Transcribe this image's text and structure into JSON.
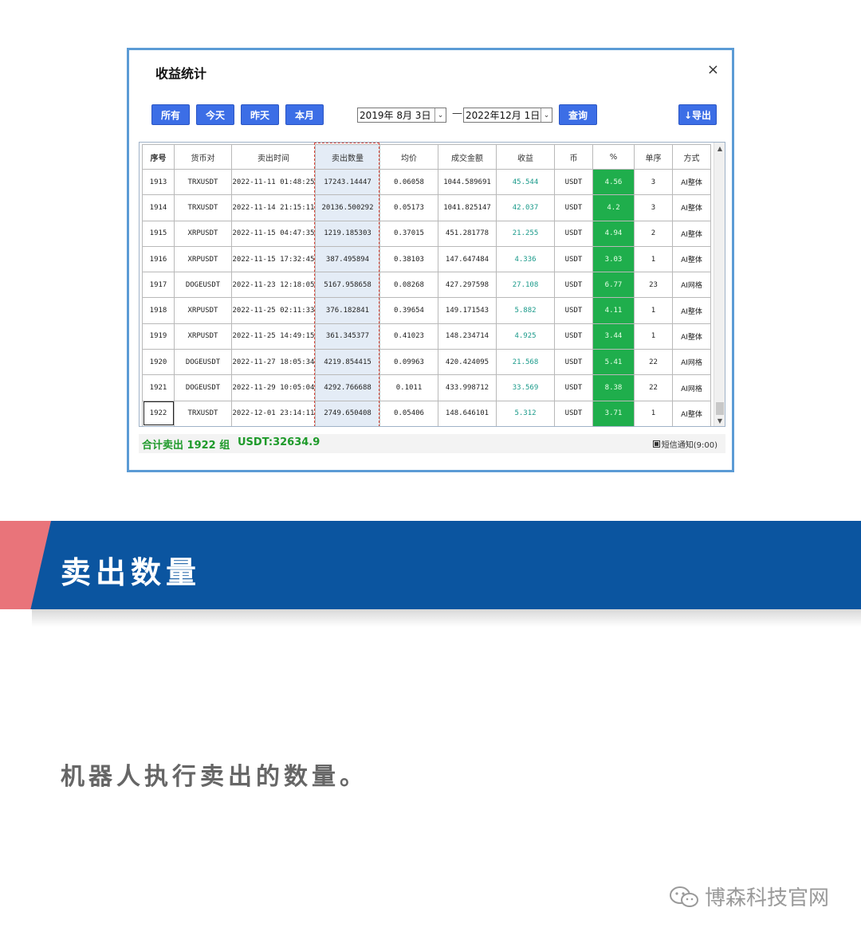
{
  "dialog": {
    "title": "收益统计",
    "close": "×",
    "buttons": [
      "所有",
      "今天",
      "昨天",
      "本月"
    ],
    "date_from": "2019年  8月  3日",
    "date_to": "2022年12月  1日",
    "date_sep": "—",
    "query": "查询",
    "export": "↓导出",
    "dropdown": "⌄"
  },
  "table": {
    "headers": [
      "序号",
      "货币对",
      "卖出时间",
      "卖出数量",
      "均价",
      "成交金额",
      "收益",
      "币",
      "%",
      "单序",
      "方式"
    ],
    "rows": [
      [
        "1913",
        "TRXUSDT",
        "2022-11-11 01:48:25",
        "17243.14447",
        "0.06058",
        "1044.589691",
        "45.544",
        "USDT",
        "4.56",
        "3",
        "AI整体"
      ],
      [
        "1914",
        "TRXUSDT",
        "2022-11-14 21:15:11",
        "20136.500292",
        "0.05173",
        "1041.825147",
        "42.037",
        "USDT",
        "4.2",
        "3",
        "AI整体"
      ],
      [
        "1915",
        "XRPUSDT",
        "2022-11-15 04:47:35",
        "1219.185303",
        "0.37015",
        "451.281778",
        "21.255",
        "USDT",
        "4.94",
        "2",
        "AI整体"
      ],
      [
        "1916",
        "XRPUSDT",
        "2022-11-15 17:32:45",
        "387.495894",
        "0.38103",
        "147.647484",
        "4.336",
        "USDT",
        "3.03",
        "1",
        "AI整体"
      ],
      [
        "1917",
        "DOGEUSDT",
        "2022-11-23 12:18:05",
        "5167.958658",
        "0.08268",
        "427.297598",
        "27.108",
        "USDT",
        "6.77",
        "23",
        "AI网格"
      ],
      [
        "1918",
        "XRPUSDT",
        "2022-11-25 02:11:33",
        "376.182841",
        "0.39654",
        "149.171543",
        "5.882",
        "USDT",
        "4.11",
        "1",
        "AI整体"
      ],
      [
        "1919",
        "XRPUSDT",
        "2022-11-25 14:49:15",
        "361.345377",
        "0.41023",
        "148.234714",
        "4.925",
        "USDT",
        "3.44",
        "1",
        "AI整体"
      ],
      [
        "1920",
        "DOGEUSDT",
        "2022-11-27 18:05:34",
        "4219.854415",
        "0.09963",
        "420.424095",
        "21.568",
        "USDT",
        "5.41",
        "22",
        "AI网格"
      ],
      [
        "1921",
        "DOGEUSDT",
        "2022-11-29 10:05:04",
        "4292.766688",
        "0.1011",
        "433.998712",
        "33.569",
        "USDT",
        "8.38",
        "22",
        "AI网格"
      ],
      [
        "1922",
        "TRXUSDT",
        "2022-12-01 23:14:11",
        "2749.650408",
        "0.05406",
        "148.646101",
        "5.312",
        "USDT",
        "3.71",
        "1",
        "AI整体"
      ]
    ]
  },
  "footer": {
    "summary": "合计卖出 1922 组",
    "usdt": "USDT:32634.9",
    "sms": "短信通知(9:00)"
  },
  "banner": {
    "title": "卖出数量"
  },
  "description": "机器人执行卖出的数量。",
  "watermark": "博森科技官网",
  "colors": {
    "accent_blue": "#0b55a0",
    "button_blue": "#3c6ee6",
    "profit_green": "#1fae4c",
    "banner_red": "#e9747a"
  }
}
